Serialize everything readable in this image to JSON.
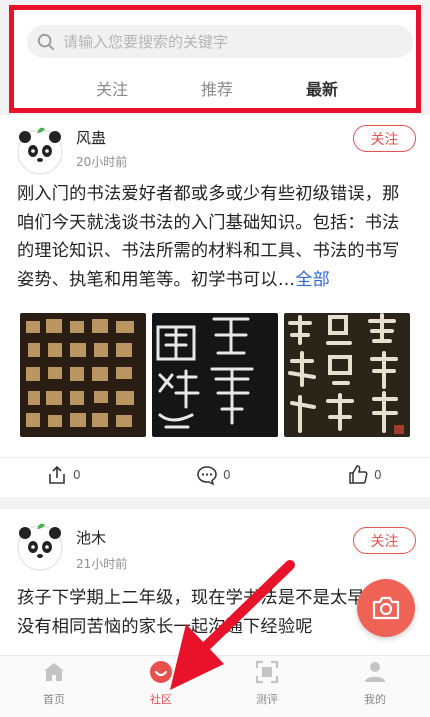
{
  "search": {
    "placeholder": "请输入您要搜索的关键字"
  },
  "tabs": [
    {
      "label": "关注"
    },
    {
      "label": "推荐"
    },
    {
      "label": "最新",
      "active": true
    }
  ],
  "posts": [
    {
      "author": "风蛊",
      "time": "20小时前",
      "follow_label": "关注",
      "text": "刚入门的书法爱好者都或多或少有些初级错误，那咱们今天就浅谈书法的入门基础知识。包括：书法的理论知识、书法所需的材料和工具、书法的书写姿势、执笔和用笔等。初学书可以…",
      "more_label": "全部",
      "images": [
        "calligraphy-image-1",
        "calligraphy-image-2",
        "calligraphy-image-3"
      ],
      "share_count": "0",
      "comment_count": "0",
      "like_count": "0"
    },
    {
      "author": "池木",
      "time": "21小时前",
      "follow_label": "关注",
      "text": "孩子下学期上二年级，现在学书法是不是太早？有没有相同苦恼的家长一起沟通下经验呢"
    }
  ],
  "bottom_nav": [
    {
      "label": "首页",
      "icon": "home-icon"
    },
    {
      "label": "社区",
      "icon": "community-icon",
      "active": true
    },
    {
      "label": "测评",
      "icon": "scan-icon"
    },
    {
      "label": "我的",
      "icon": "profile-icon"
    }
  ],
  "colors": {
    "accent": "#e8504f",
    "highlight": "#e8132a",
    "link": "#2e6bd8"
  }
}
